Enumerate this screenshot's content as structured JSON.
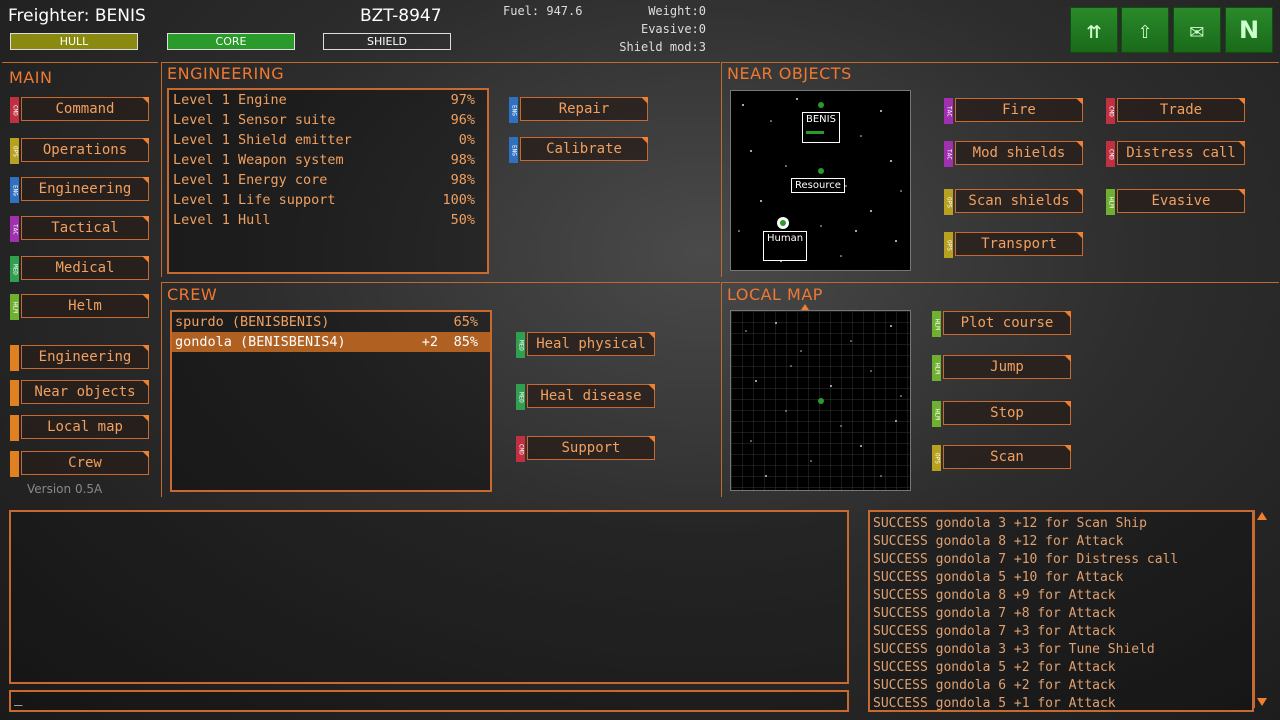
{
  "ship": {
    "title": "Freighter: BENIS",
    "registration": "BZT-8947"
  },
  "bars": {
    "hull": "HULL",
    "core": "CORE",
    "shield": "SHIELD"
  },
  "stats": {
    "fuel_label": "Fuel:",
    "fuel_value": "947.6",
    "weight_label": "Weight:",
    "weight_value": "0",
    "evasive_label": "Evasive:",
    "evasive_value": "0",
    "shieldmod_label": "Shield mod:",
    "shieldmod_value": "3"
  },
  "top_buttons": [
    "crew-transfer-icon",
    "upload-person-icon",
    "mail-icon",
    "nav-north-icon"
  ],
  "top_button_glyphs": {
    "crew": "⇈",
    "up": "⇧",
    "mail": "✉",
    "north": "N"
  },
  "main": {
    "title": "MAIN",
    "items": [
      {
        "label": "Command",
        "tag": "CMD"
      },
      {
        "label": "Operations",
        "tag": "OPS"
      },
      {
        "label": "Engineering",
        "tag": "ENG"
      },
      {
        "label": "Tactical",
        "tag": "TAC"
      },
      {
        "label": "Medical",
        "tag": "MED"
      },
      {
        "label": "Helm",
        "tag": "HLM"
      }
    ],
    "views": [
      "Engineering",
      "Near objects",
      "Local map",
      "Crew"
    ],
    "version": "Version 0.5A"
  },
  "engineering": {
    "title": "ENGINEERING",
    "systems": [
      {
        "name": "Level 1 Engine",
        "pct": "97%"
      },
      {
        "name": "Level 1 Sensor suite",
        "pct": "96%"
      },
      {
        "name": "Level 1 Shield emitter",
        "pct": "0%"
      },
      {
        "name": "Level 1 Weapon system",
        "pct": "98%"
      },
      {
        "name": "Level 1 Energy core",
        "pct": "98%"
      },
      {
        "name": "Level 1 Life support",
        "pct": "100%"
      },
      {
        "name": "Level 1 Hull",
        "pct": "50%"
      }
    ],
    "buttons": [
      {
        "label": "Repair",
        "tag": "ENG"
      },
      {
        "label": "Calibrate",
        "tag": "ENG"
      }
    ]
  },
  "near_objects": {
    "title": "NEAR OBJECTS",
    "labels": {
      "ship": "BENIS",
      "resource": "Resource",
      "human": "Human"
    },
    "buttons": [
      {
        "label": "Fire",
        "tag": "TAC"
      },
      {
        "label": "Mod shields",
        "tag": "TAC"
      },
      {
        "label": "Scan shields",
        "tag": "OPS"
      },
      {
        "label": "Transport",
        "tag": "OPS"
      },
      {
        "label": "Trade",
        "tag": "CMD"
      },
      {
        "label": "Distress call",
        "tag": "CMD"
      },
      {
        "label": "Evasive",
        "tag": "HLM"
      }
    ]
  },
  "crew": {
    "title": "CREW",
    "members": [
      {
        "name": "spurdo (BENISBENIS)",
        "bonus": "",
        "pct": "65%"
      },
      {
        "name": "gondola (BENISBENIS4)",
        "bonus": "+2",
        "pct": "85%"
      }
    ],
    "buttons": [
      {
        "label": "Heal physical",
        "tag": "MED"
      },
      {
        "label": "Heal disease",
        "tag": "MED"
      },
      {
        "label": "Support",
        "tag": "CMD"
      }
    ]
  },
  "local_map": {
    "title": "LOCAL MAP",
    "buttons": [
      {
        "label": "Plot course",
        "tag": "HLM"
      },
      {
        "label": "Jump",
        "tag": "HLM"
      },
      {
        "label": "Stop",
        "tag": "HLM"
      },
      {
        "label": "Scan",
        "tag": "OPS"
      }
    ]
  },
  "log": [
    "SUCCESS gondola 3 +12 for Scan Ship",
    "SUCCESS gondola 8 +12 for Attack",
    "SUCCESS gondola 7 +10 for Distress call",
    "SUCCESS gondola 5 +10 for Attack",
    "SUCCESS gondola 8 +9 for Attack",
    "SUCCESS gondola 7 +8 for Attack",
    "SUCCESS gondola 7 +3 for Attack",
    "SUCCESS gondola 3 +3 for Tune Shield",
    "SUCCESS gondola 5 +2 for Attack",
    "SUCCESS gondola 6 +2 for Attack",
    "SUCCESS gondola 5 +1 for Attack"
  ],
  "console": {
    "prompt": "_"
  },
  "colors": {
    "accent": "#f07830",
    "hull": "#8a8a10",
    "core": "#2a9a2a",
    "selected": "#b06020"
  }
}
